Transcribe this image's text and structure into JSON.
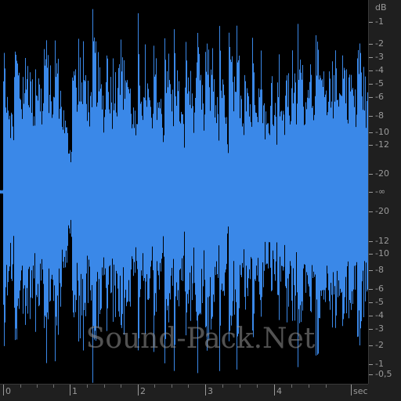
{
  "waveform": {
    "color": "#3a88e8",
    "background": "#000000",
    "center_line_db": "-∞"
  },
  "db_scale": {
    "unit": "dB",
    "labels": [
      "-1",
      "-2",
      "-3",
      "-4",
      "-5",
      "-6",
      "-8",
      "-10",
      "-12",
      "-20",
      "-∞",
      "-20",
      "-12",
      "-10",
      "-8",
      "-6",
      "-5",
      "-4",
      "-3",
      "-2",
      "-1",
      "-0,5"
    ]
  },
  "time_scale": {
    "unit": "sec",
    "labels": [
      "0",
      "1",
      "2",
      "3",
      "4"
    ]
  },
  "watermark": {
    "text": "Sound-Pack.Net"
  }
}
